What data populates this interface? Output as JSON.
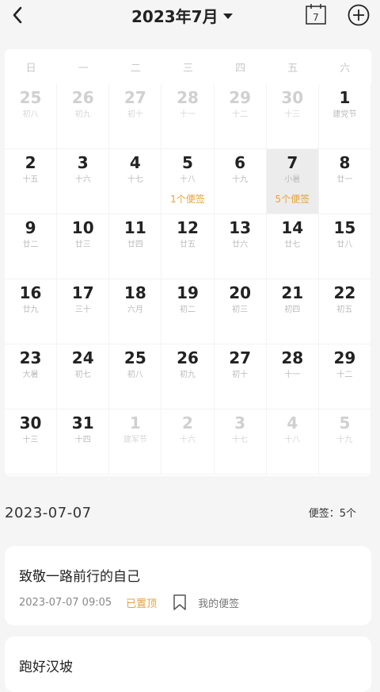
{
  "header": {
    "back_icon": "chevron-left-icon",
    "month_title": "2023年7月",
    "today_day": "7",
    "add_icon": "plus-circle-icon"
  },
  "calendar": {
    "weekdays": [
      "日",
      "一",
      "二",
      "三",
      "四",
      "五",
      "六"
    ],
    "days": [
      {
        "day": "25",
        "lunar": "初八",
        "other": true
      },
      {
        "day": "26",
        "lunar": "初九",
        "other": true
      },
      {
        "day": "27",
        "lunar": "初十",
        "other": true
      },
      {
        "day": "28",
        "lunar": "十一",
        "other": true
      },
      {
        "day": "29",
        "lunar": "十二",
        "other": true
      },
      {
        "day": "30",
        "lunar": "十三",
        "other": true
      },
      {
        "day": "1",
        "lunar": "建党节"
      },
      {
        "day": "2",
        "lunar": "十五"
      },
      {
        "day": "3",
        "lunar": "十六"
      },
      {
        "day": "4",
        "lunar": "十七"
      },
      {
        "day": "5",
        "lunar": "十八",
        "note": "1个便签"
      },
      {
        "day": "6",
        "lunar": "十九"
      },
      {
        "day": "7",
        "lunar": "小暑",
        "note": "5个便签",
        "selected": true
      },
      {
        "day": "8",
        "lunar": "廿一"
      },
      {
        "day": "9",
        "lunar": "廿二"
      },
      {
        "day": "10",
        "lunar": "廿三"
      },
      {
        "day": "11",
        "lunar": "廿四"
      },
      {
        "day": "12",
        "lunar": "廿五"
      },
      {
        "day": "13",
        "lunar": "廿六"
      },
      {
        "day": "14",
        "lunar": "廿七"
      },
      {
        "day": "15",
        "lunar": "廿八"
      },
      {
        "day": "16",
        "lunar": "廿九"
      },
      {
        "day": "17",
        "lunar": "三十"
      },
      {
        "day": "18",
        "lunar": "六月"
      },
      {
        "day": "19",
        "lunar": "初二"
      },
      {
        "day": "20",
        "lunar": "初三"
      },
      {
        "day": "21",
        "lunar": "初四"
      },
      {
        "day": "22",
        "lunar": "初五"
      },
      {
        "day": "23",
        "lunar": "大暑"
      },
      {
        "day": "24",
        "lunar": "初七"
      },
      {
        "day": "25",
        "lunar": "初八"
      },
      {
        "day": "26",
        "lunar": "初九"
      },
      {
        "day": "27",
        "lunar": "初十"
      },
      {
        "day": "28",
        "lunar": "十一"
      },
      {
        "day": "29",
        "lunar": "十二"
      },
      {
        "day": "30",
        "lunar": "十三"
      },
      {
        "day": "31",
        "lunar": "十四"
      },
      {
        "day": "1",
        "lunar": "建军节",
        "other": true
      },
      {
        "day": "2",
        "lunar": "十六",
        "other": true
      },
      {
        "day": "3",
        "lunar": "十七",
        "other": true
      },
      {
        "day": "4",
        "lunar": "十八",
        "other": true
      },
      {
        "day": "5",
        "lunar": "十九",
        "other": true
      }
    ]
  },
  "selected": {
    "date": "2023-07-07",
    "count_label": "便签：5个"
  },
  "notes": [
    {
      "title": "致敬一路前行的自己",
      "time": "2023-07-07 09:05",
      "pinned": "已置顶",
      "bookmark_icon": "bookmark-icon",
      "folder": "我的便签"
    },
    {
      "title": "跑好汉坡"
    }
  ],
  "colors": {
    "accent": "#e6a23c",
    "selected_bg": "#ececec",
    "muted": "#d0d0d0"
  }
}
